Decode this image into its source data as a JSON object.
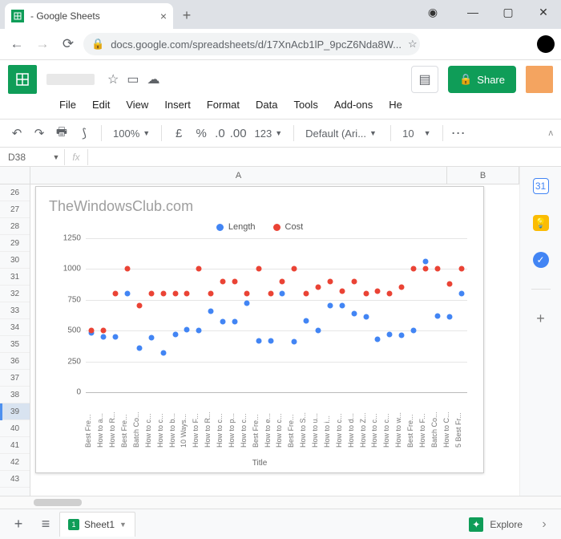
{
  "browser": {
    "tab_title": "- Google Sheets",
    "url": "docs.google.com/spreadsheets/d/17XnAcb1lP_9pcZ6Nda8W..."
  },
  "menus": [
    "File",
    "Edit",
    "View",
    "Insert",
    "Format",
    "Data",
    "Tools",
    "Add-ons",
    "He"
  ],
  "toolbar": {
    "zoom": "100%",
    "currency": "£",
    "pct": "%",
    "dec_less": ".0",
    "dec_more": ".00",
    "numfmt": "123",
    "font": "Default (Ari...",
    "fontsize": "10"
  },
  "share_label": "Share",
  "cell_ref": "D38",
  "col_headers": [
    "A",
    "B"
  ],
  "row_start": 26,
  "row_end": 43,
  "selected_row": 39,
  "sheet_tab": "Sheet1",
  "explore_label": "Explore",
  "chart_data": {
    "type": "scatter",
    "title": "TheWindowsClub.com",
    "xlabel": "Title",
    "ylabel": "",
    "ylim": [
      0,
      1250
    ],
    "yticks": [
      0,
      250,
      500,
      750,
      1000,
      1250
    ],
    "categories": [
      "Best Fre...",
      "How to a...",
      "How to R...",
      "Best Fre...",
      "Batch Co...",
      "How to c...",
      "How to c...",
      "How to b...",
      "10 Ways...",
      "How to F...",
      "How to R...",
      "How to c...",
      "How to p...",
      "How to c...",
      "Best Fre...",
      "How to e...",
      "How to c...",
      "Best Fre...",
      "How to S...",
      "How to u...",
      "How to i...",
      "How to c...",
      "How to d...",
      "How to Z...",
      "How to c...",
      "How to c...",
      "How to w...",
      "Best Fre...",
      "How to F...",
      "Batch Co...",
      "How to C...",
      "5 Best Fr..."
    ],
    "series": [
      {
        "name": "Length",
        "color": "#4285f4",
        "values": [
          480,
          450,
          450,
          800,
          360,
          440,
          320,
          470,
          510,
          500,
          660,
          570,
          570,
          720,
          420,
          420,
          800,
          410,
          580,
          500,
          700,
          700,
          640,
          610,
          430,
          470,
          460,
          500,
          1060,
          620,
          610,
          800
        ]
      },
      {
        "name": "Cost",
        "color": "#ea4335",
        "values": [
          500,
          500,
          800,
          1000,
          700,
          800,
          800,
          800,
          800,
          1000,
          800,
          900,
          900,
          800,
          1000,
          800,
          900,
          1000,
          800,
          850,
          900,
          820,
          900,
          800,
          820,
          800,
          850,
          1000,
          1000,
          1000,
          880,
          1000
        ]
      }
    ]
  }
}
